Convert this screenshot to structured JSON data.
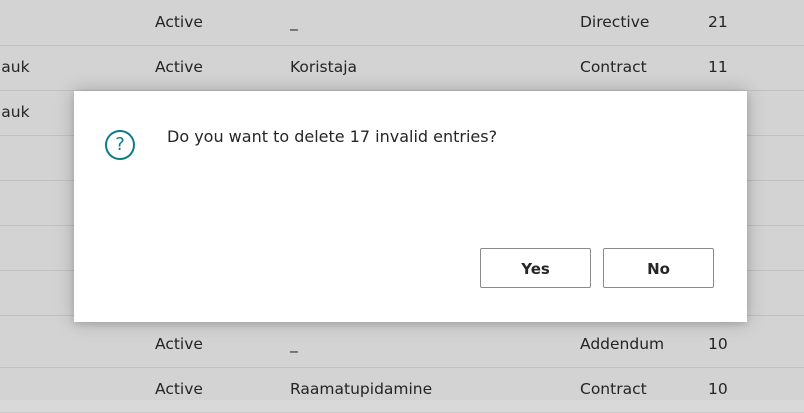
{
  "table": {
    "rows": [
      {
        "c0": "",
        "c1": "Active",
        "c2": "_",
        "c3": "Directive",
        "c4": "21"
      },
      {
        "c0": "iauk",
        "c1": "Active",
        "c2": "Koristaja",
        "c3": "Contract",
        "c4": "11"
      },
      {
        "c0": "iauk",
        "c1": "",
        "c2": "",
        "c3": "",
        "c4": ""
      },
      {
        "c0": "",
        "c1": "",
        "c2": "",
        "c3": "",
        "c4": ""
      },
      {
        "c0": "",
        "c1": "",
        "c2": "",
        "c3": "",
        "c4": ""
      },
      {
        "c0": "",
        "c1": "",
        "c2": "",
        "c3": "",
        "c4": ""
      },
      {
        "c0": "",
        "c1": "",
        "c2": "",
        "c3": "",
        "c4": ""
      },
      {
        "c0": "",
        "c1": "Active",
        "c2": "_",
        "c3": "Addendum",
        "c4": "10"
      },
      {
        "c0": "",
        "c1": "Active",
        "c2": "Raamatupidamine",
        "c3": "Contract",
        "c4": "10"
      }
    ]
  },
  "dialog": {
    "icon": "question-circle-icon",
    "icon_glyph": "?",
    "message": "Do you want to delete 17 invalid entries?",
    "yes_label": "Yes",
    "no_label": "No",
    "accent_color": "#0e7c86"
  }
}
